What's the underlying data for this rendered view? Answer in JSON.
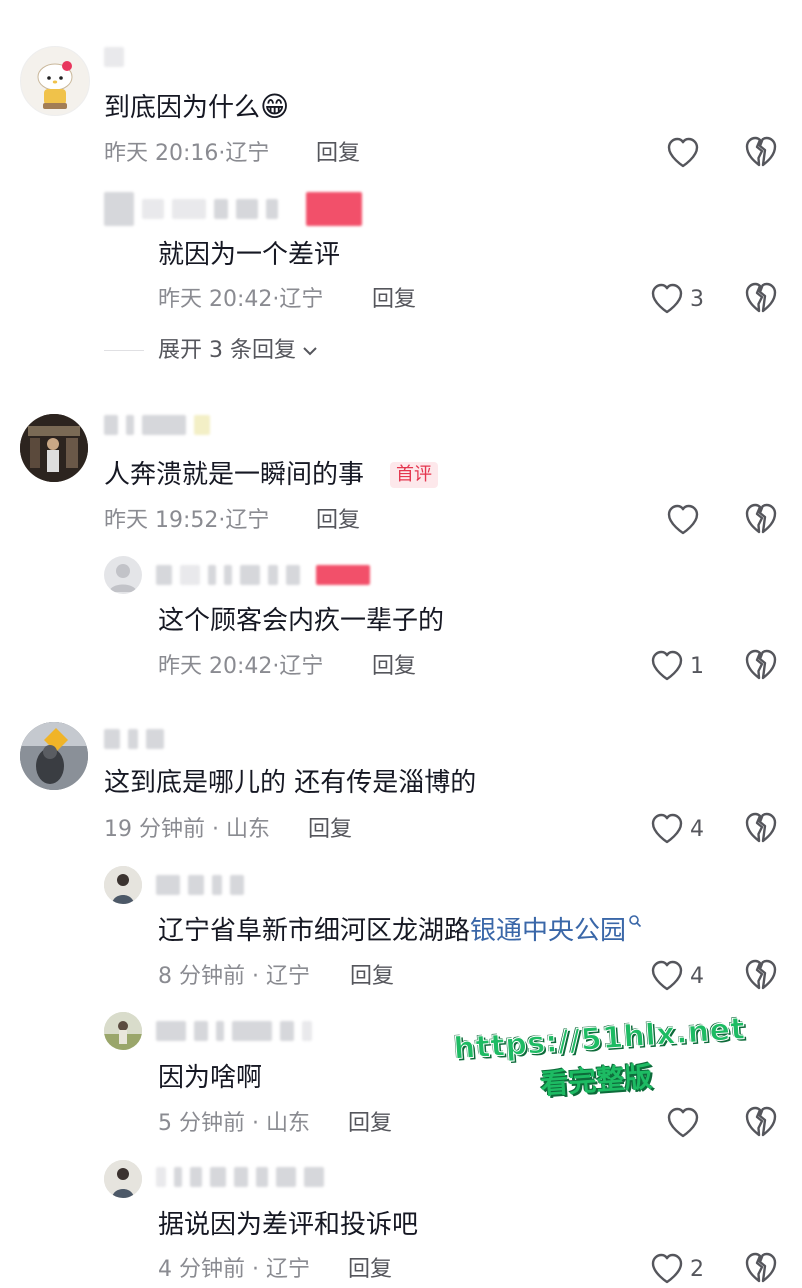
{
  "comments": [
    {
      "text": "到底因为什么",
      "emoji": "😁",
      "time": "昨天 20:16",
      "location": "辽宁",
      "reply_label": "回复",
      "replies": [
        {
          "text": "就因为一个差评",
          "time": "昨天 20:42",
          "location": "辽宁",
          "reply_label": "回复",
          "likes": "3"
        }
      ],
      "expand_label": "展开 3 条回复"
    },
    {
      "text": "人奔溃就是一瞬间的事",
      "badge": "首评",
      "time": "昨天 19:52",
      "location": "辽宁",
      "reply_label": "回复",
      "replies": [
        {
          "text": "这个顾客会内疚一辈子的",
          "time": "昨天 20:42",
          "location": "辽宁",
          "reply_label": "回复",
          "likes": "1"
        }
      ]
    },
    {
      "text": "这到底是哪儿的 还有传是淄博的",
      "time": "19 分钟前",
      "location": "山东",
      "reply_label": "回复",
      "likes": "4",
      "replies": [
        {
          "text_plain": "辽宁省阜新市细河区龙湖路",
          "text_link": "银通中央公园",
          "time": "8 分钟前",
          "location": "辽宁",
          "reply_label": "回复",
          "likes": "4"
        },
        {
          "text": "因为啥啊",
          "time": "5 分钟前",
          "location": "山东",
          "reply_label": "回复"
        },
        {
          "text": "据说因为差评和投诉吧",
          "time": "4 分钟前",
          "location": "辽宁",
          "reply_label": "回复",
          "likes": "2"
        }
      ]
    }
  ],
  "sep": "·",
  "watermark": {
    "line1": "https://51hlx.net",
    "line2": "看完整版"
  },
  "icons": {
    "like": "heart-outline-icon",
    "dislike": "broken-heart-icon",
    "search": "search-icon",
    "chevron": "chevron-down-icon"
  },
  "colors": {
    "link": "#3a67a8",
    "badge": "#e4364f",
    "watermark": "#1dbb63"
  }
}
